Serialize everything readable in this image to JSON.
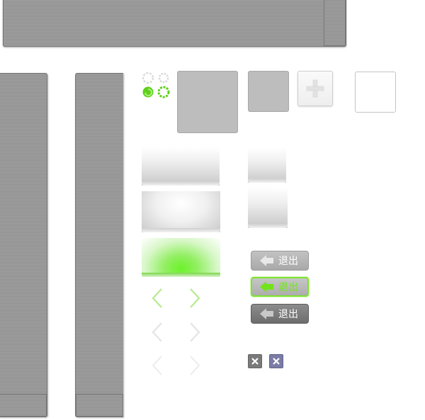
{
  "sprite_sheet": {
    "exit_buttons": [
      {
        "label": "退出",
        "state": "normal"
      },
      {
        "label": "退出",
        "state": "active"
      },
      {
        "label": "退出",
        "state": "pressed"
      }
    ],
    "icons": {
      "status_icon": "refresh-icon",
      "settings_icon": "gear-icon",
      "add_icon": "plus-icon",
      "back_icon": "arrow-left-icon",
      "close_icon": "close-icon"
    },
    "colors": {
      "accent_green": "#6ce51e",
      "panel_gray": "#999999",
      "dark_button": "#7a7a7a",
      "purple_button": "#7b7ca6"
    }
  }
}
